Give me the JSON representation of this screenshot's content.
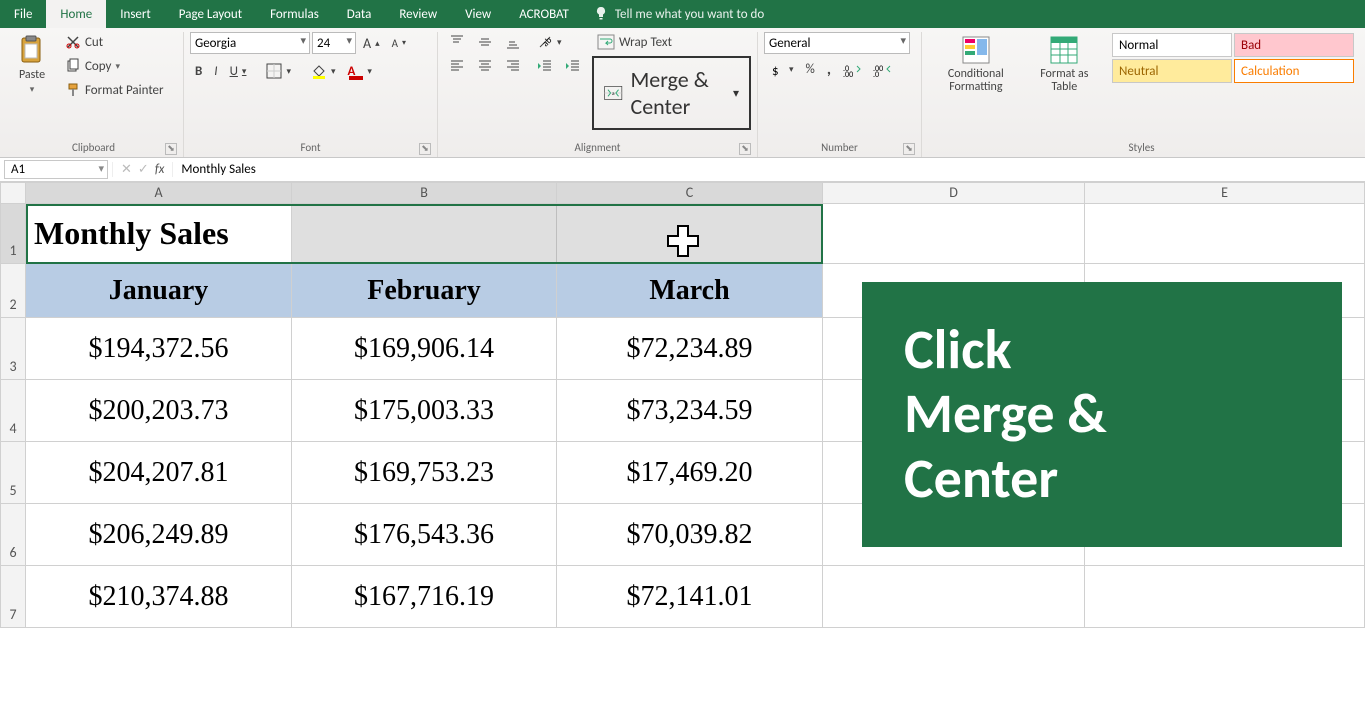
{
  "tabs": {
    "file": "File",
    "home": "Home",
    "insert": "Insert",
    "pageLayout": "Page Layout",
    "formulas": "Formulas",
    "data": "Data",
    "review": "Review",
    "view": "View",
    "acrobat": "ACROBAT",
    "tellme": "Tell me what you want to do"
  },
  "clipboard": {
    "paste": "Paste",
    "cut": "Cut",
    "copy": "Copy",
    "formatPainter": "Format Painter",
    "group": "Clipboard"
  },
  "font": {
    "name": "Georgia",
    "size": "24",
    "group": "Font",
    "bold": "B",
    "italic": "I",
    "underline": "U"
  },
  "alignment": {
    "wrap": "Wrap Text",
    "merge": "Merge & Center",
    "group": "Alignment"
  },
  "number": {
    "format": "General",
    "percent": "%",
    "comma": ",",
    "group": "Number"
  },
  "styles": {
    "cond": "Conditional Formatting",
    "table": "Format as Table",
    "normal": "Normal",
    "bad": "Bad",
    "neutral": "Neutral",
    "calc": "Calculation",
    "group": "Styles"
  },
  "formulaBar": {
    "ref": "A1",
    "fx": "fx",
    "value": "Monthly Sales"
  },
  "columns": [
    "A",
    "B",
    "C",
    "D",
    "E"
  ],
  "data": {
    "title": "Monthly Sales",
    "headers": [
      "January",
      "February",
      "March"
    ],
    "rows": [
      [
        "$194,372.56",
        "$169,906.14",
        "$72,234.89"
      ],
      [
        "$200,203.73",
        "$175,003.33",
        "$73,234.59"
      ],
      [
        "$204,207.81",
        "$169,753.23",
        "$17,469.20"
      ],
      [
        "$206,249.89",
        "$176,543.36",
        "$70,039.82"
      ],
      [
        "$210,374.88",
        "$167,716.19",
        "$72,141.01"
      ]
    ]
  },
  "overlay": {
    "l1": "Click",
    "l2": "Merge &",
    "l3": "Center"
  }
}
